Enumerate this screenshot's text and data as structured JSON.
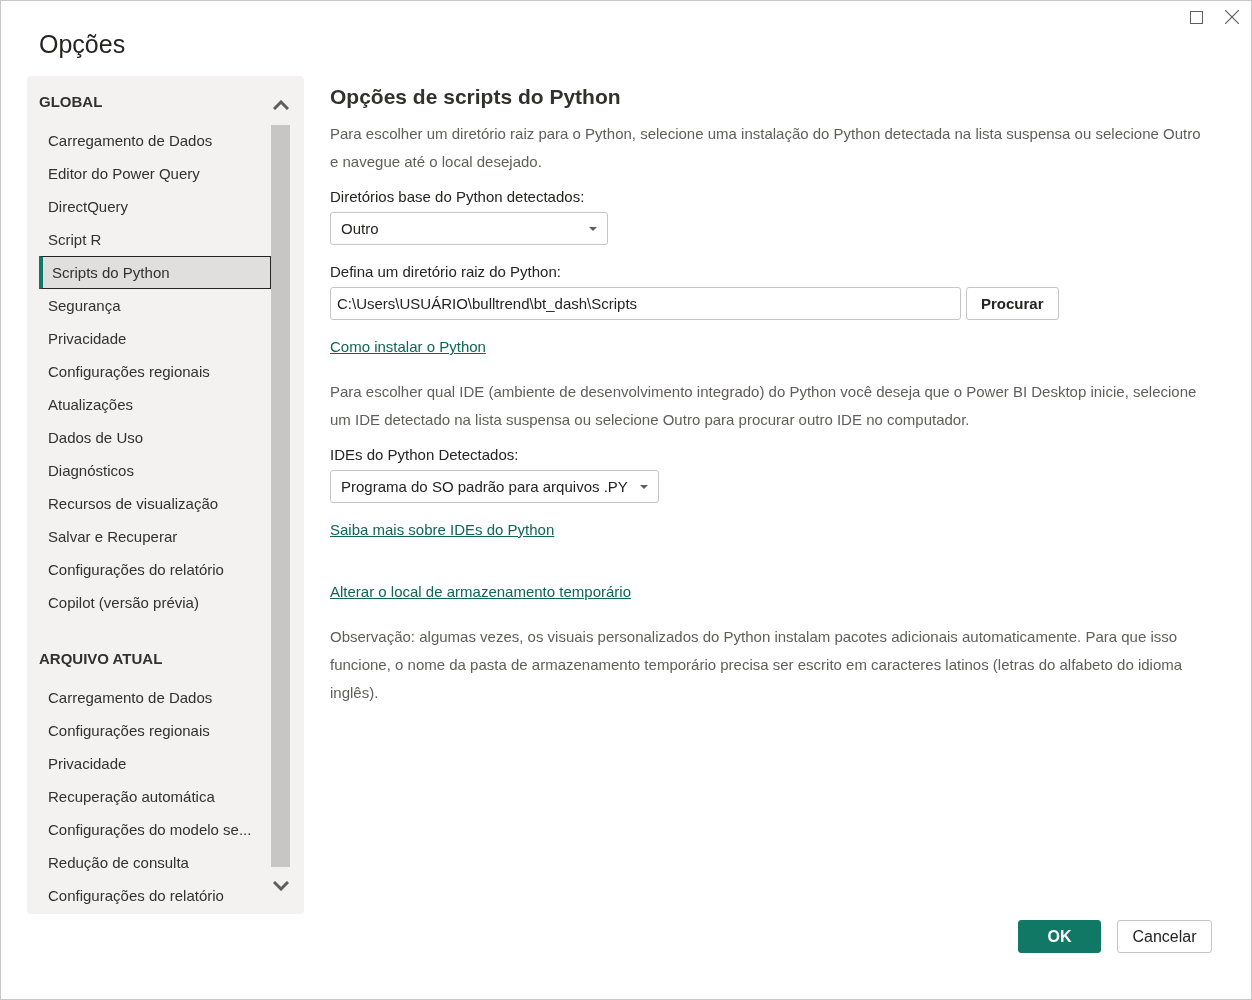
{
  "window": {
    "title": "Opções"
  },
  "sidebar": {
    "sections": [
      {
        "heading": "GLOBAL",
        "items": [
          {
            "label": "Carregamento de Dados",
            "selected": false
          },
          {
            "label": "Editor do Power Query",
            "selected": false
          },
          {
            "label": "DirectQuery",
            "selected": false
          },
          {
            "label": "Script R",
            "selected": false
          },
          {
            "label": "Scripts do Python",
            "selected": true
          },
          {
            "label": "Segurança",
            "selected": false
          },
          {
            "label": "Privacidade",
            "selected": false
          },
          {
            "label": "Configurações regionais",
            "selected": false
          },
          {
            "label": "Atualizações",
            "selected": false
          },
          {
            "label": "Dados de Uso",
            "selected": false
          },
          {
            "label": "Diagnósticos",
            "selected": false
          },
          {
            "label": "Recursos de visualização",
            "selected": false
          },
          {
            "label": "Salvar e Recuperar",
            "selected": false
          },
          {
            "label": "Configurações do relatório",
            "selected": false
          },
          {
            "label": "Copilot (versão prévia)",
            "selected": false
          }
        ]
      },
      {
        "heading": "ARQUIVO ATUAL",
        "items": [
          {
            "label": "Carregamento de Dados",
            "selected": false
          },
          {
            "label": "Configurações regionais",
            "selected": false
          },
          {
            "label": "Privacidade",
            "selected": false
          },
          {
            "label": "Recuperação automática",
            "selected": false
          },
          {
            "label": "Configurações do modelo se...",
            "selected": false
          },
          {
            "label": "Redução de consulta",
            "selected": false
          },
          {
            "label": "Configurações do relatório",
            "selected": false
          }
        ]
      }
    ]
  },
  "content": {
    "title": "Opções de scripts do Python",
    "blocks": [
      {
        "kind": "paragraph",
        "text": "Para escolher um diretório raiz para o Python, selecione uma instalação do Python detectada na lista suspensa ou selecione Outro e navegue até o local desejado."
      },
      {
        "kind": "dropdown",
        "label": "Diretórios base do Python detectados:",
        "value": "Outro"
      },
      {
        "kind": "path",
        "label": "Defina um diretório raiz do Python:",
        "value": "C:\\Users\\USUÁRIO\\bulltrend\\bt_dash\\Scripts",
        "button": "Procurar"
      },
      {
        "kind": "link",
        "text": "Como instalar o Python"
      },
      {
        "kind": "paragraph",
        "text": "Para escolher qual IDE (ambiente de desenvolvimento integrado) do Python você deseja que o Power BI Desktop inicie, selecione um IDE detectado na lista suspensa ou selecione Outro para procurar outro IDE no computador."
      },
      {
        "kind": "dropdown",
        "label": "IDEs do Python Detectados:",
        "value": "Programa do SO padrão para arquivos .PY"
      },
      {
        "kind": "link",
        "text": "Saiba mais sobre IDEs do Python"
      },
      {
        "kind": "link",
        "text": "Alterar o local de armazenamento temporário"
      },
      {
        "kind": "paragraph",
        "text": "Observação: algumas vezes, os visuais personalizados do Python instalam pacotes adicionais automaticamente. Para que isso funcione, o nome da pasta de armazenamento temporário precisa ser escrito em caracteres latinos (letras do alfabeto do idioma inglês)."
      }
    ]
  },
  "buttons": [
    {
      "label": "OK",
      "kind": "primary"
    },
    {
      "label": "Cancelar",
      "kind": "secondary"
    }
  ]
}
